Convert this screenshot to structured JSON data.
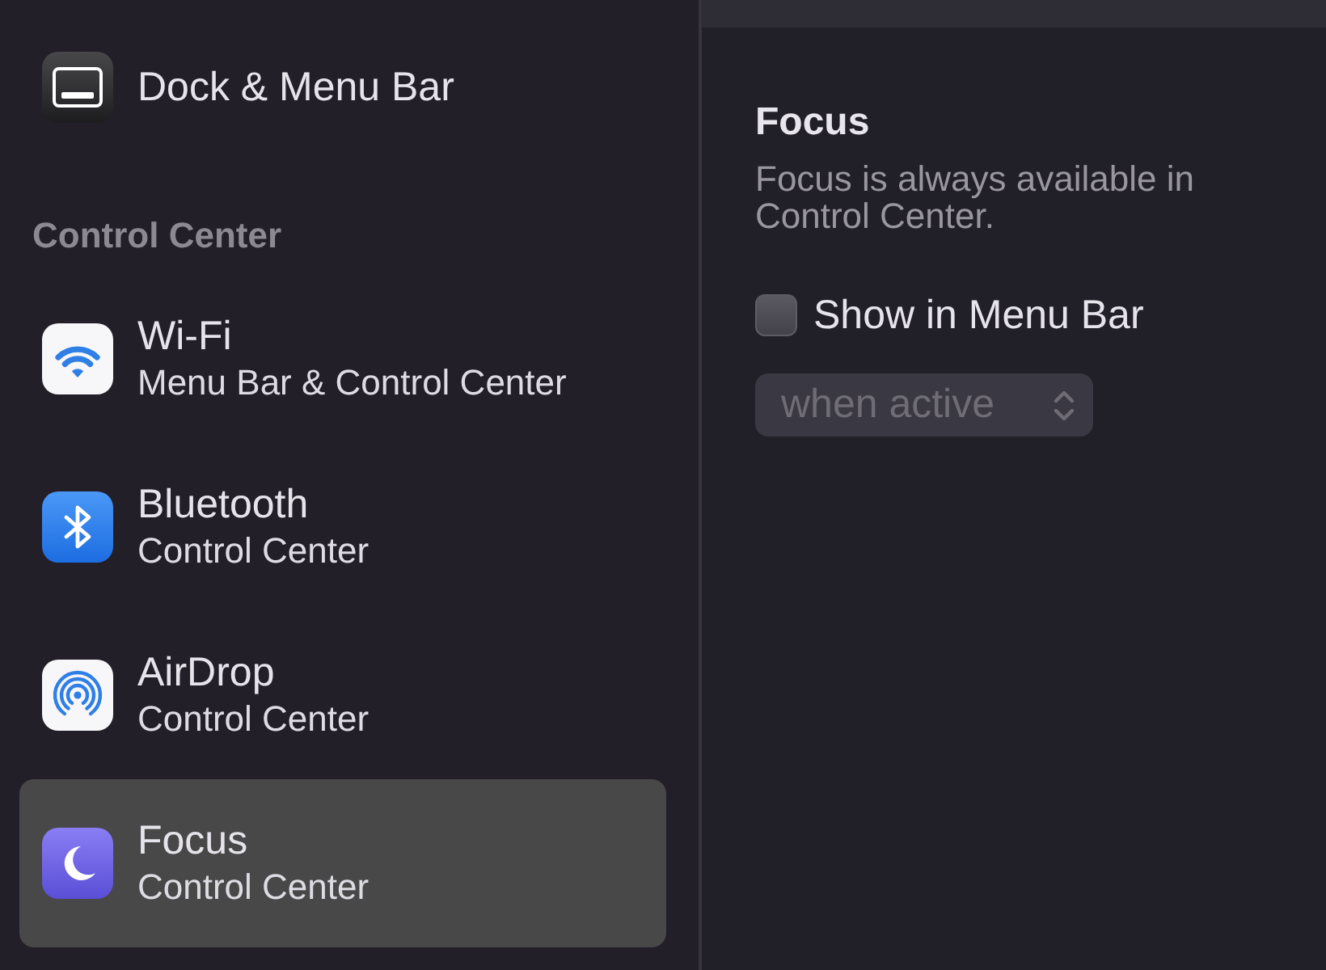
{
  "sidebar": {
    "groups": [
      {
        "items": [
          {
            "title": "Dock & Menu Bar",
            "selected": false
          }
        ]
      },
      {
        "heading": "Control Center",
        "items": [
          {
            "title": "Wi-Fi",
            "subtitle": "Menu Bar & Control Center",
            "selected": false
          },
          {
            "title": "Bluetooth",
            "subtitle": "Control Center",
            "selected": false
          },
          {
            "title": "AirDrop",
            "subtitle": "Control Center",
            "selected": false
          },
          {
            "title": "Focus",
            "subtitle": "Control Center",
            "selected": true
          }
        ]
      }
    ]
  },
  "detail": {
    "title": "Focus",
    "description": "Focus is always available in Control Center.",
    "checkbox": {
      "label": "Show in Menu Bar",
      "checked": false
    },
    "popup": {
      "value": "when active",
      "disabled": true
    }
  }
}
